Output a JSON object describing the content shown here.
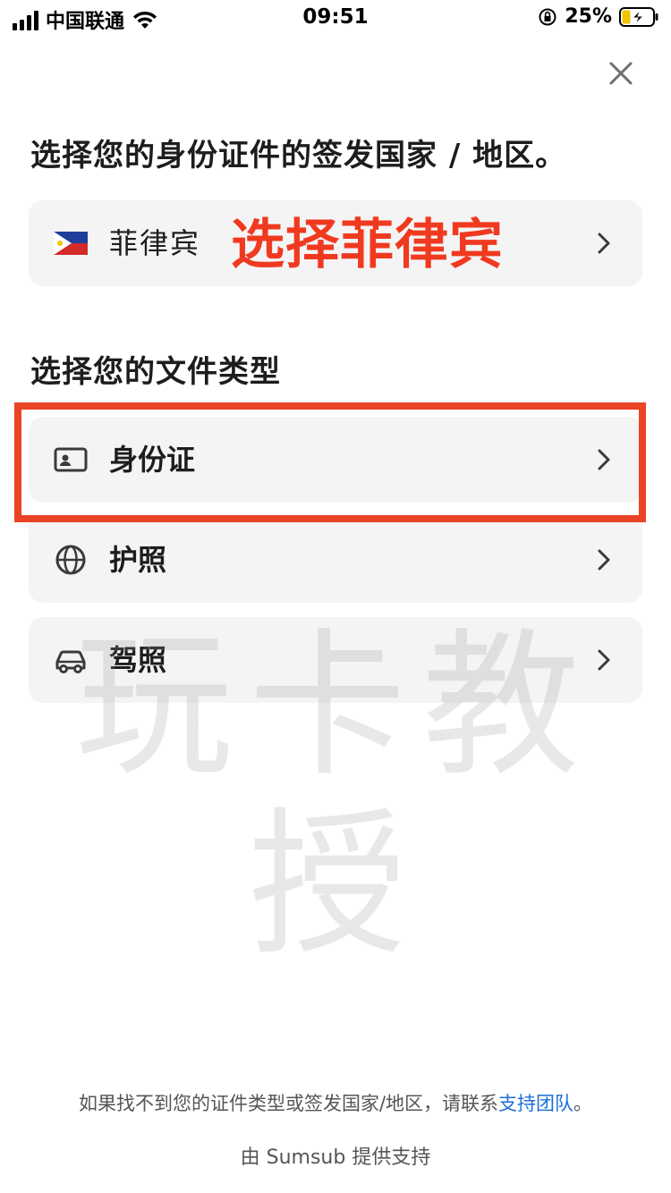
{
  "status_bar": {
    "carrier": "中国联通",
    "time": "09:51",
    "battery_percent": "25%"
  },
  "icons": {
    "close": "close-icon",
    "chevron": "chevron-right-icon",
    "id_card": "id-card-icon",
    "globe": "globe-icon",
    "car": "car-icon",
    "flag": "philippines-flag-icon"
  },
  "colors": {
    "accent_link": "#1e6fd9",
    "annotation_red": "#f03a20",
    "card_bg": "#f4f4f5"
  },
  "country_section": {
    "title": "选择您的身份证件的签发国家 / 地区。",
    "selected_country": "菲律宾",
    "annotation": "选择菲律宾"
  },
  "document_section": {
    "title": "选择您的文件类型",
    "options": [
      {
        "label": "身份证"
      },
      {
        "label": "护照"
      },
      {
        "label": "驾照"
      }
    ]
  },
  "watermark": "玩卡教授",
  "footer": {
    "note_prefix": "如果找不到您的证件类型或签发国家/地区，请联系",
    "note_link": "支持团队",
    "note_suffix": "。",
    "powered_by": "由 Sumsub 提供支持"
  }
}
